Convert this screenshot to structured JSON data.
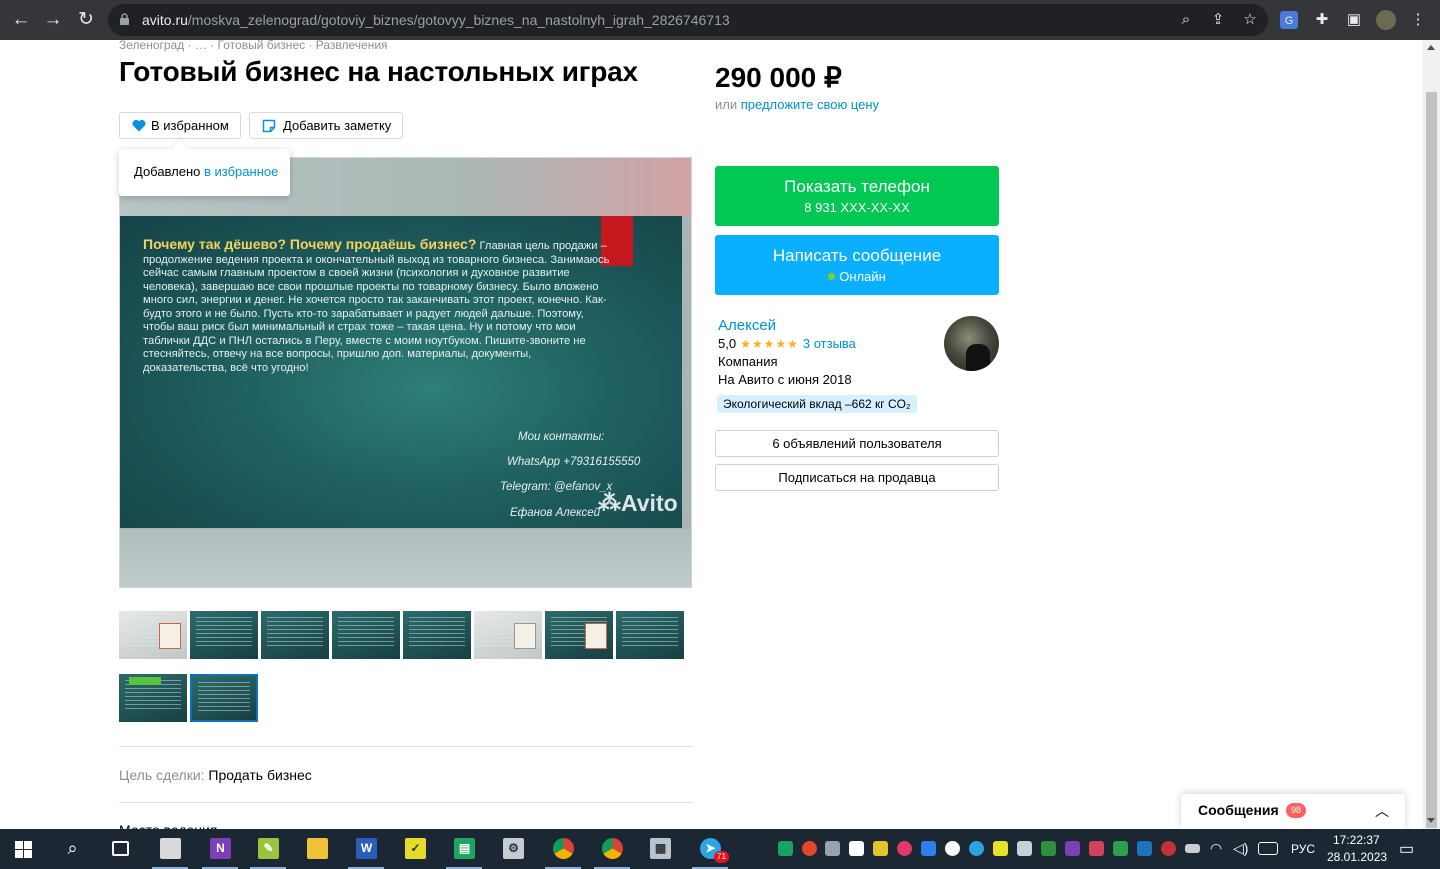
{
  "browser": {
    "url_host": "avito.ru",
    "url_path": "/moskva_zelenograd/gotoviy_biznes/gotovyy_biznes_na_nastolnyh_igrah_2826746713"
  },
  "listing": {
    "breadcrumb": "Зеленоград · … · Готовый бизнес · Развлечения",
    "title": "Готовый бизнес на настольных играх",
    "favorite_label": "В избранном",
    "note_label": "Добавить заметку",
    "tooltip_text": "Добавлено",
    "tooltip_link": "в избранное",
    "slide": {
      "question": "Почему так дёшево? Почему продаёшь бизнес?",
      "body": " Главная цель продажи – продолжение ведения проекта и окончательный выход из товарного бизнеса. Занимаюсь сейчас самым главным проектом в своей жизни (психология и духовное развитие человека), завершаю все свои прошлые проекты по товарному бизнесу. Было вложено много сил, энергии и денег. Не хочется просто так заканчивать этот проект, конечно. Как-будто этого и не было. Пусть кто-то зарабатывает и радует людей дальше. Поэтому, чтобы ваш риск был минимальный и страх тоже – такая цена. Ну и потому что мои таблички ДДС и ПНЛ остались в Перу, вместе с моим ноутбуком. Пишите-звоните не стесняйтесь, отвечу на все вопросы, пришлю доп. материалы, документы, доказательства, всё что угодно!",
      "contacts_title": "Мои контакты:",
      "whatsapp": "WhatsApp +79316155550",
      "telegram": "Telegram: @efanov_x",
      "name": "Ефанов Алексей",
      "watermark": "Avito"
    },
    "deal_label": "Цель сделки:",
    "deal_value": "Продать бизнес",
    "next_label": "Место ведения"
  },
  "sidebar": {
    "price": "290 000 ₽",
    "offer_prefix": "или",
    "offer_link": "предложите свою цену",
    "show_phone": "Показать телефон",
    "phone_mask": "8 931 XXX-XX-XX",
    "write_message": "Написать сообщение",
    "online": "Онлайн",
    "seller": {
      "name": "Алексей",
      "rating": "5,0",
      "stars": "★★★★★",
      "reviews": "3 отзыва",
      "type": "Компания",
      "since": "На Авито с июня 2018",
      "eco": "Экологический вклад –662 кг CO₂"
    },
    "user_ads": "6 объявлений пользователя",
    "subscribe": "Подписаться на продавца"
  },
  "messages": {
    "label": "Сообщения",
    "badge": "98"
  },
  "taskbar": {
    "language": "РУС",
    "time": "17:22:37",
    "date": "28.01.2023",
    "telegram_badge": "71"
  },
  "colors": {
    "green_button": "#00c853",
    "blue_button": "#0ab0ff",
    "link": "#0091d9"
  }
}
